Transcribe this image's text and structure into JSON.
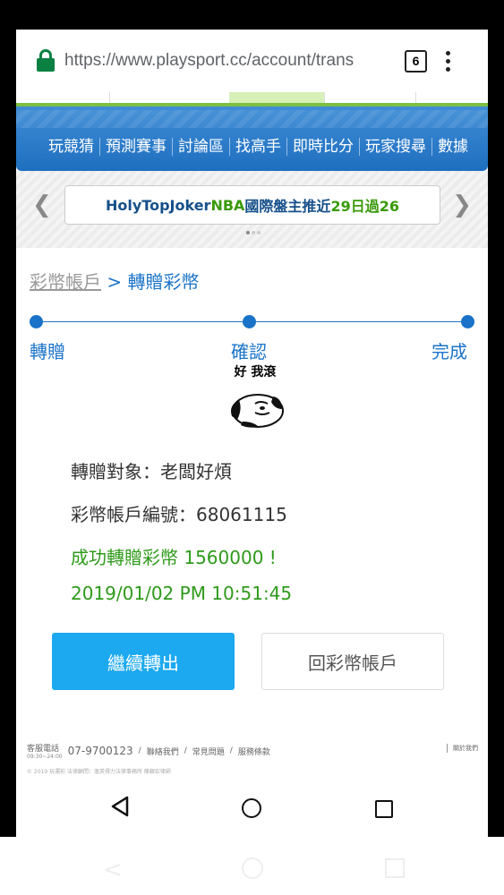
{
  "browser": {
    "url_host": "https://www.playsport.cc",
    "url_path": "/account/trans",
    "tab_count": "6"
  },
  "nav": {
    "items": [
      "玩競猜",
      "預測賽事",
      "討論區",
      "找高手",
      "即時比分",
      "玩家搜尋",
      "數據"
    ]
  },
  "marquee": {
    "part1": "HolyTopJoker ",
    "part2": "NBA",
    "part3": " 國際盤主推近",
    "part4": "29日過26"
  },
  "breadcrumb": {
    "parent": "彩幣帳戶",
    "separator": " > ",
    "current": "轉贈彩幣"
  },
  "steps": [
    "轉贈",
    "確認",
    "完成"
  ],
  "meme": {
    "caption": "好 我滾"
  },
  "result": {
    "recipient": "轉贈對象：老闆好煩",
    "account": "彩幣帳戶編號：68061115",
    "success": "成功轉贈彩幣 1560000 !",
    "timestamp": "2019/01/02 PM 10:51:45"
  },
  "buttons": {
    "continue": "繼續轉出",
    "back_to_account": "回彩幣帳戶"
  },
  "footer": {
    "phone_label": "客服電話",
    "hours": "09:30~24:00",
    "phone": "07-9700123",
    "links": [
      "聯絡我們",
      "常見問題",
      "服務條款"
    ],
    "about": "關於我們",
    "copyright": "© 2019 玩運彩 法律顧問：滙英得力法律事務所 陳銀宏律師"
  },
  "colors": {
    "accent": "#1a73c8",
    "primary_button": "#1ca9f0",
    "success": "#2e9a1a",
    "nav_bg": "#2a7bcc"
  }
}
